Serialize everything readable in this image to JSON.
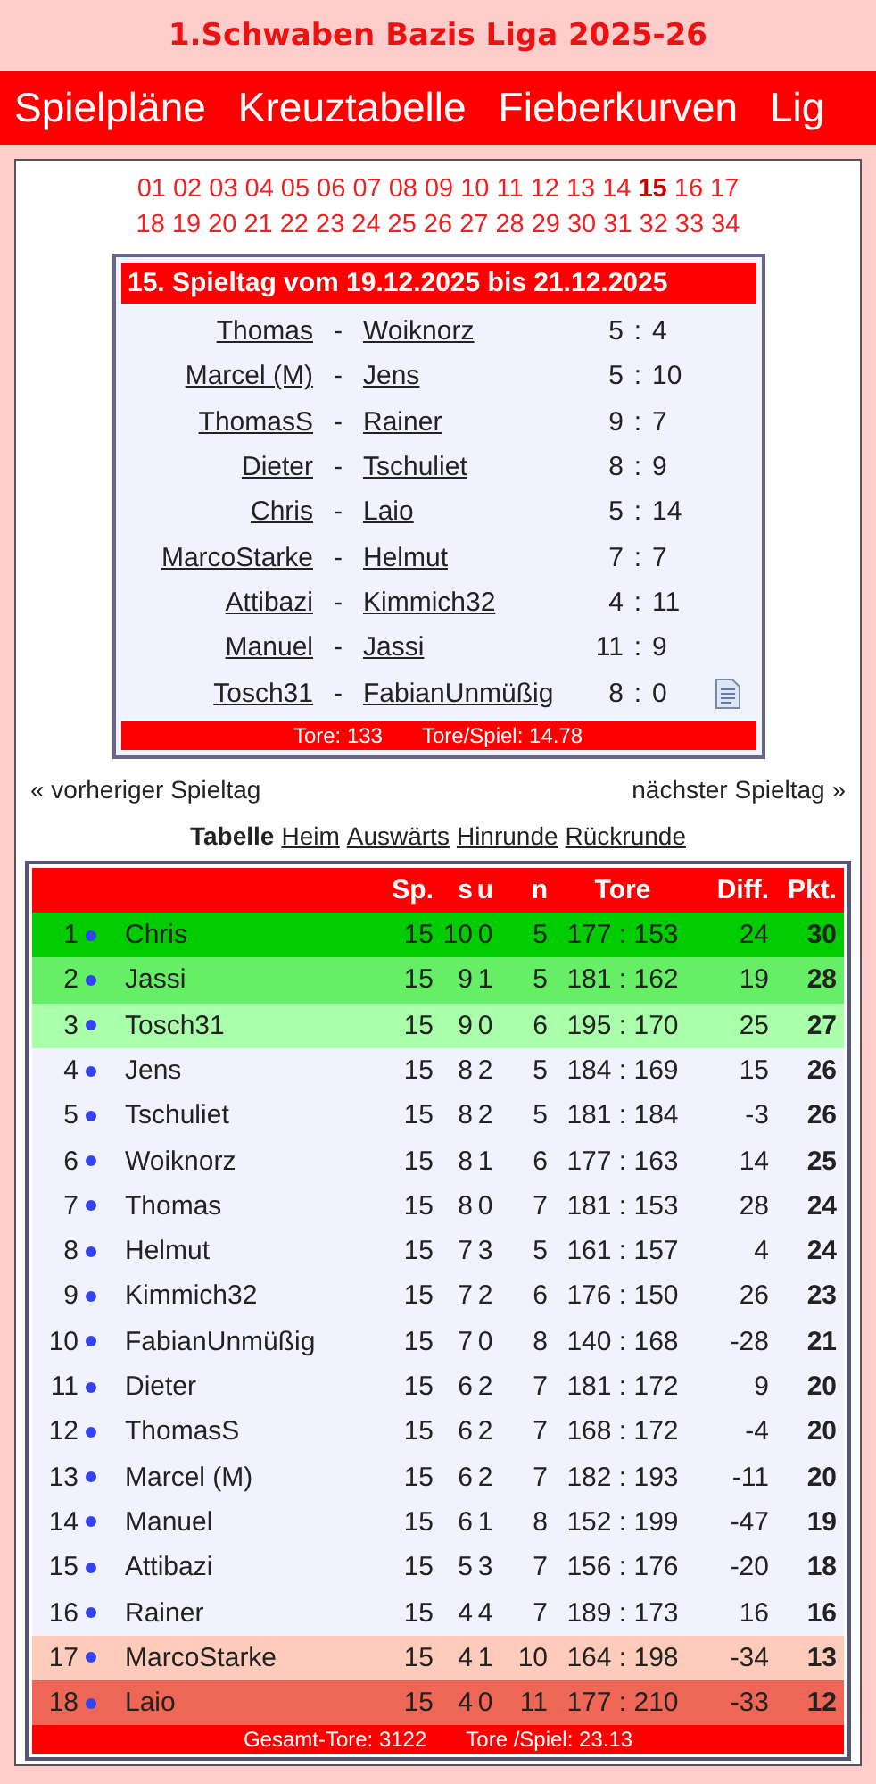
{
  "title": "1.Schwaben Bazis Liga 2025-26",
  "nav": [
    {
      "label": "Spielpläne"
    },
    {
      "label": "Kreuztabelle"
    },
    {
      "label": "Fieberkurven"
    },
    {
      "label": "Lig"
    }
  ],
  "matchdays": [
    {
      "label": "01",
      "selected": false
    },
    {
      "label": "02",
      "selected": false
    },
    {
      "label": "03",
      "selected": false
    },
    {
      "label": "04",
      "selected": false
    },
    {
      "label": "05",
      "selected": false
    },
    {
      "label": "06",
      "selected": false
    },
    {
      "label": "07",
      "selected": false
    },
    {
      "label": "08",
      "selected": false
    },
    {
      "label": "09",
      "selected": false
    },
    {
      "label": "10",
      "selected": false
    },
    {
      "label": "11",
      "selected": false
    },
    {
      "label": "12",
      "selected": false
    },
    {
      "label": "13",
      "selected": false
    },
    {
      "label": "14",
      "selected": false
    },
    {
      "label": "15",
      "selected": true
    },
    {
      "label": "16",
      "selected": false
    },
    {
      "label": "17",
      "selected": false
    },
    {
      "label": "18",
      "selected": false
    },
    {
      "label": "19",
      "selected": false
    },
    {
      "label": "20",
      "selected": false
    },
    {
      "label": "21",
      "selected": false
    },
    {
      "label": "22",
      "selected": false
    },
    {
      "label": "23",
      "selected": false
    },
    {
      "label": "24",
      "selected": false
    },
    {
      "label": "25",
      "selected": false
    },
    {
      "label": "26",
      "selected": false
    },
    {
      "label": "27",
      "selected": false
    },
    {
      "label": "28",
      "selected": false
    },
    {
      "label": "29",
      "selected": false
    },
    {
      "label": "30",
      "selected": false
    },
    {
      "label": "31",
      "selected": false
    },
    {
      "label": "32",
      "selected": false
    },
    {
      "label": "33",
      "selected": false
    },
    {
      "label": "34",
      "selected": false
    }
  ],
  "fixtures": {
    "heading": "15. Spieltag vom 19.12.2025 bis 21.12.2025",
    "separator": "-",
    "matches": [
      {
        "home": "Thomas",
        "away": "Woiknorz",
        "home_goals": "5",
        "away_goals": "4",
        "report": false
      },
      {
        "home": "Marcel (M)",
        "away": "Jens",
        "home_goals": "5",
        "away_goals": "10",
        "report": false
      },
      {
        "home": "ThomasS",
        "away": "Rainer",
        "home_goals": "9",
        "away_goals": "7",
        "report": false
      },
      {
        "home": "Dieter",
        "away": "Tschuliet",
        "home_goals": "8",
        "away_goals": "9",
        "report": false
      },
      {
        "home": "Chris",
        "away": "Laio",
        "home_goals": "5",
        "away_goals": "14",
        "report": false
      },
      {
        "home": "MarcoStarke",
        "away": "Helmut",
        "home_goals": "7",
        "away_goals": "7",
        "report": false
      },
      {
        "home": "Attibazi",
        "away": "Kimmich32",
        "home_goals": "4",
        "away_goals": "11",
        "report": false
      },
      {
        "home": "Manuel",
        "away": "Jassi",
        "home_goals": "11",
        "away_goals": "9",
        "report": false
      },
      {
        "home": "Tosch31",
        "away": "FabianUnmüßig",
        "home_goals": "8",
        "away_goals": "0",
        "report": true
      }
    ],
    "score_separator": ":",
    "footer": [
      "Tore: 133",
      "Tore/Spiel: 14.78"
    ]
  },
  "prev_link": "« vorheriger Spieltag",
  "next_link": "nächster Spieltag »",
  "table_tabs": [
    {
      "label": "Tabelle",
      "selected": true
    },
    {
      "label": "Heim",
      "selected": false
    },
    {
      "label": "Auswärts",
      "selected": false
    },
    {
      "label": "Hinrunde",
      "selected": false
    },
    {
      "label": "Rückrunde",
      "selected": false
    }
  ],
  "table": {
    "columns": [
      "Sp.",
      "s",
      "u",
      "n",
      "Tore",
      "Diff.",
      "Pkt."
    ],
    "rows": [
      {
        "rank": "1",
        "name": "Chris",
        "sp": "15",
        "s": "10",
        "u": "0",
        "n": "5",
        "tore": "177 : 153",
        "diff": "24",
        "pkt": "30",
        "color": "#00cc00"
      },
      {
        "rank": "2",
        "name": "Jassi",
        "sp": "15",
        "s": "9",
        "u": "1",
        "n": "5",
        "tore": "181 : 162",
        "diff": "19",
        "pkt": "28",
        "color": "#66ee66"
      },
      {
        "rank": "3",
        "name": "Tosch31",
        "sp": "15",
        "s": "9",
        "u": "0",
        "n": "6",
        "tore": "195 : 170",
        "diff": "25",
        "pkt": "27",
        "color": "#aaffaa"
      },
      {
        "rank": "4",
        "name": "Jens",
        "sp": "15",
        "s": "8",
        "u": "2",
        "n": "5",
        "tore": "184 : 169",
        "diff": "15",
        "pkt": "26",
        "color": "#f2f2ff"
      },
      {
        "rank": "5",
        "name": "Tschuliet",
        "sp": "15",
        "s": "8",
        "u": "2",
        "n": "5",
        "tore": "181 : 184",
        "diff": "-3",
        "pkt": "26",
        "color": "#f2f2ff"
      },
      {
        "rank": "6",
        "name": "Woiknorz",
        "sp": "15",
        "s": "8",
        "u": "1",
        "n": "6",
        "tore": "177 : 163",
        "diff": "14",
        "pkt": "25",
        "color": "#f2f2ff"
      },
      {
        "rank": "7",
        "name": "Thomas",
        "sp": "15",
        "s": "8",
        "u": "0",
        "n": "7",
        "tore": "181 : 153",
        "diff": "28",
        "pkt": "24",
        "color": "#f2f2ff"
      },
      {
        "rank": "8",
        "name": "Helmut",
        "sp": "15",
        "s": "7",
        "u": "3",
        "n": "5",
        "tore": "161 : 157",
        "diff": "4",
        "pkt": "24",
        "color": "#f2f2ff"
      },
      {
        "rank": "9",
        "name": "Kimmich32",
        "sp": "15",
        "s": "7",
        "u": "2",
        "n": "6",
        "tore": "176 : 150",
        "diff": "26",
        "pkt": "23",
        "color": "#f2f2ff"
      },
      {
        "rank": "10",
        "name": "FabianUnmüßig",
        "sp": "15",
        "s": "7",
        "u": "0",
        "n": "8",
        "tore": "140 : 168",
        "diff": "-28",
        "pkt": "21",
        "color": "#f2f2ff"
      },
      {
        "rank": "11",
        "name": "Dieter",
        "sp": "15",
        "s": "6",
        "u": "2",
        "n": "7",
        "tore": "181 : 172",
        "diff": "9",
        "pkt": "20",
        "color": "#f2f2ff"
      },
      {
        "rank": "12",
        "name": "ThomasS",
        "sp": "15",
        "s": "6",
        "u": "2",
        "n": "7",
        "tore": "168 : 172",
        "diff": "-4",
        "pkt": "20",
        "color": "#f2f2ff"
      },
      {
        "rank": "13",
        "name": "Marcel (M)",
        "sp": "15",
        "s": "6",
        "u": "2",
        "n": "7",
        "tore": "182 : 193",
        "diff": "-11",
        "pkt": "20",
        "color": "#f2f2ff"
      },
      {
        "rank": "14",
        "name": "Manuel",
        "sp": "15",
        "s": "6",
        "u": "1",
        "n": "8",
        "tore": "152 : 199",
        "diff": "-47",
        "pkt": "19",
        "color": "#f2f2ff"
      },
      {
        "rank": "15",
        "name": "Attibazi",
        "sp": "15",
        "s": "5",
        "u": "3",
        "n": "7",
        "tore": "156 : 176",
        "diff": "-20",
        "pkt": "18",
        "color": "#f2f2ff"
      },
      {
        "rank": "16",
        "name": "Rainer",
        "sp": "15",
        "s": "4",
        "u": "4",
        "n": "7",
        "tore": "189 : 173",
        "diff": "16",
        "pkt": "16",
        "color": "#f2f2ff"
      },
      {
        "rank": "17",
        "name": "MarcoStarke",
        "sp": "15",
        "s": "4",
        "u": "1",
        "n": "10",
        "tore": "164 : 198",
        "diff": "-34",
        "pkt": "13",
        "color": "#ffccbb"
      },
      {
        "rank": "18",
        "name": "Laio",
        "sp": "15",
        "s": "4",
        "u": "0",
        "n": "11",
        "tore": "177 : 210",
        "diff": "-33",
        "pkt": "12",
        "color": "#ee6655"
      }
    ],
    "footer": [
      "Gesamt-Tore: 3122",
      "Tore /Spiel: 23.13"
    ]
  }
}
